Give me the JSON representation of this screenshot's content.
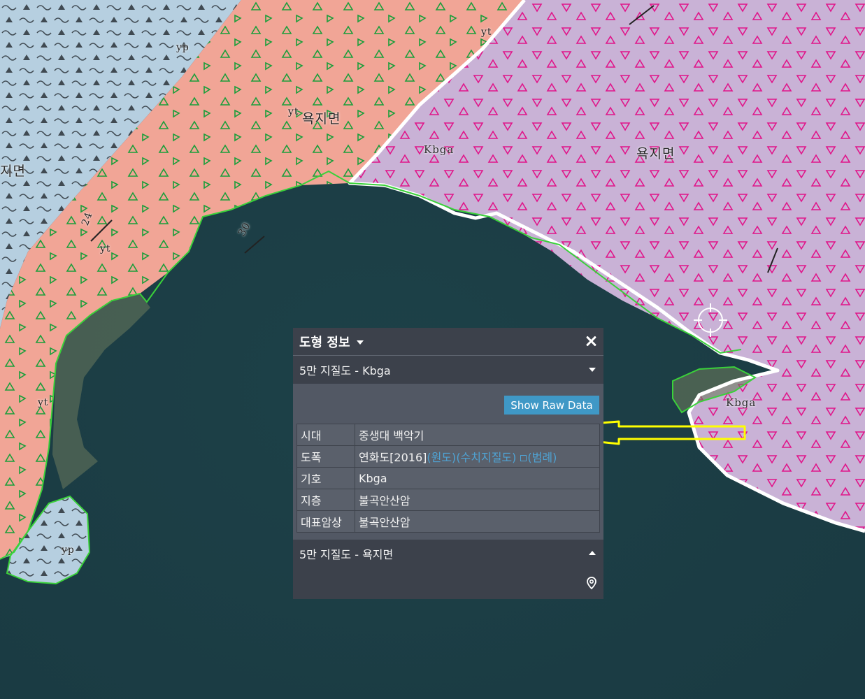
{
  "map": {
    "labels": {
      "place_1": "욕지면",
      "place_2": "욕지면",
      "place_3": "지면",
      "unit_kbga_1": "Kbga",
      "unit_kbga_2": "Kbga",
      "unit_yp_1": "yp",
      "unit_yp_2": "yp",
      "unit_yt_1": "yt",
      "unit_yt_2": "yt",
      "unit_yt_3": "yt",
      "unit_yt_4": "yt",
      "dip_1": "24",
      "dip_2": "30"
    },
    "colors": {
      "sea": "#1c3f47",
      "unit_yp": "#b6cfe0",
      "unit_yt": "#f1a596",
      "unit_kbga": "#c9b2d6",
      "kbga_symbol": "#e0158a",
      "yt_symbol": "#1a9e3a",
      "coastline": "#3ad13a",
      "highlight_boundary": "#ffffff",
      "annotation_arrow": "#ffff00"
    }
  },
  "panel": {
    "title": "도형 정보",
    "section_1": "5만 지질도 - Kbga",
    "raw_button": "Show Raw Data",
    "rows": [
      {
        "key": "시대",
        "value": "중생대  백악기"
      },
      {
        "key": "도폭",
        "value": "연화도[2016]"
      },
      {
        "key": "기호",
        "value": "Kbga"
      },
      {
        "key": "지층",
        "value": "불곡안산암"
      },
      {
        "key": "대표암상",
        "value": "불곡안산암"
      }
    ],
    "links": {
      "original": "(원도)",
      "digital": "(수치지질도)",
      "legend": "(범례)"
    },
    "section_2": "5만 지질도 - 욕지면",
    "icons": {
      "dropdown": "caret-down-icon",
      "close": "close-icon",
      "expand": "chevron-down-icon",
      "collapse": "chevron-up-icon",
      "external": "external-link-icon",
      "locate": "map-pin-icon"
    }
  }
}
